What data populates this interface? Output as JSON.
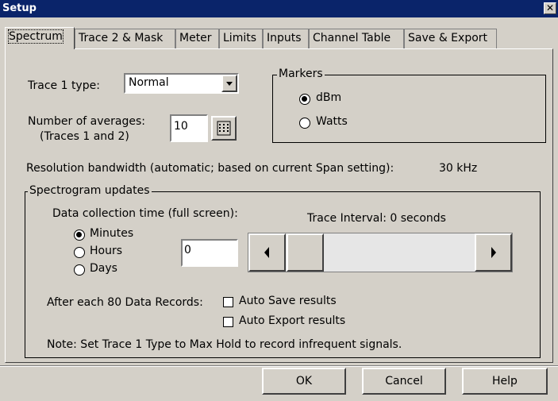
{
  "window": {
    "title": "Setup",
    "close_glyph": "✕"
  },
  "tabs": [
    {
      "label": "Spectrum",
      "active": true
    },
    {
      "label": "Trace 2 & Mask",
      "active": false
    },
    {
      "label": "Meter",
      "active": false
    },
    {
      "label": "Limits",
      "active": false
    },
    {
      "label": "Inputs",
      "active": false
    },
    {
      "label": "Channel Table",
      "active": false
    },
    {
      "label": "Save & Export",
      "active": false
    }
  ],
  "trace1": {
    "label": "Trace 1 type:",
    "value": "Normal"
  },
  "averages": {
    "label_line1": "Number of averages:",
    "label_line2": "(Traces 1 and 2)",
    "value": "10"
  },
  "markers": {
    "legend": "Markers",
    "options": [
      {
        "label": "dBm",
        "checked": true
      },
      {
        "label": "Watts",
        "checked": false
      }
    ]
  },
  "rbw": {
    "label": "Resolution bandwidth (automatic; based on current Span setting):",
    "value": "30 kHz"
  },
  "spectrogram": {
    "legend": "Spectrogram updates",
    "collection_label": "Data collection time (full screen):",
    "trace_interval": "Trace Interval: 0 seconds",
    "units": [
      {
        "label": "Minutes",
        "checked": true
      },
      {
        "label": "Hours",
        "checked": false
      },
      {
        "label": "Days",
        "checked": false
      }
    ],
    "time_value": "0",
    "slider_level": 0,
    "after_label": "After each 80 Data Records:",
    "auto_save": {
      "label": "Auto Save results",
      "checked": false
    },
    "auto_export": {
      "label": "Auto Export results",
      "checked": false
    },
    "note": "Note: Set Trace 1 Type to Max Hold to record infrequent signals."
  },
  "buttons": {
    "ok": "OK",
    "cancel": "Cancel",
    "help": "Help"
  }
}
